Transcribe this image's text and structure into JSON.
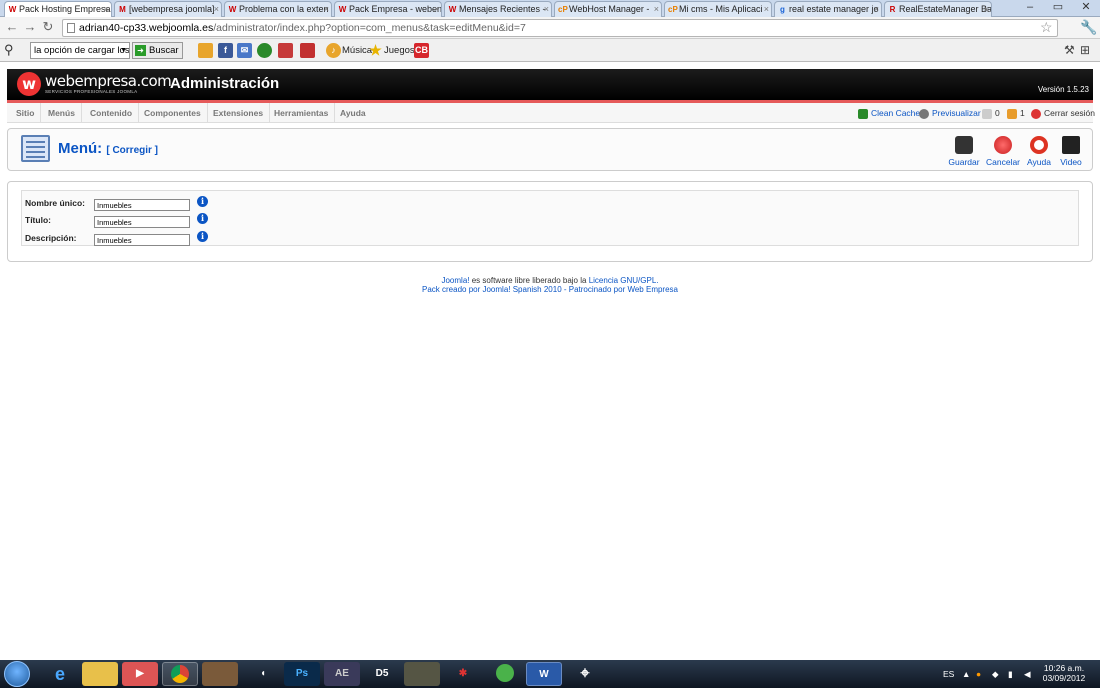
{
  "browser": {
    "tabs": [
      {
        "label": "Pack Hosting Empresa",
        "fav": "W",
        "active": true
      },
      {
        "label": "[webempresa joomla]",
        "fav": "M",
        "active": false
      },
      {
        "label": "Problema con la exten",
        "fav": "W",
        "active": false
      },
      {
        "label": "Pack Empresa - weben",
        "fav": "W",
        "active": false
      },
      {
        "label": "Mensajes Recientes -",
        "fav": "W",
        "active": false
      },
      {
        "label": "WebHost Manager -",
        "fav": "cP",
        "active": false
      },
      {
        "label": "Mi cms - Mis Aplicaci",
        "fav": "cP",
        "active": false
      },
      {
        "label": "real estate manager jo",
        "fav": "g",
        "active": false
      },
      {
        "label": "RealEstateManager Ba",
        "fav": "R",
        "active": false
      }
    ],
    "url_host": "adrian40-cp33.webjoomla.es",
    "url_path": "/administrator/index.php?option=com_menus&task=editMenu&id=7",
    "toolbar": {
      "search_value": "la opción de cargar los",
      "search_button": "Buscar",
      "musica": "Música",
      "juegos": "Juegos"
    }
  },
  "header": {
    "logo": "webempresa.com",
    "logo_sub": "SERVICIOS PROFESIONALES JOOMLA",
    "title": "Administración",
    "version": "Versión 1.5.23"
  },
  "menubar": {
    "items": [
      "Sitio",
      "Menús",
      "Contenido",
      "Componentes",
      "Extensiones",
      "Herramientas",
      "Ayuda"
    ],
    "clean_cache": "Clean Cache",
    "preview": "Previsualizar",
    "messages_count": "0",
    "users_count": "1",
    "logout": "Cerrar sesión"
  },
  "page": {
    "title": "Menú:",
    "subtitle": "[ Corregir ]",
    "buttons": {
      "save": "Guardar",
      "cancel": "Cancelar",
      "help": "Ayuda",
      "video": "Video"
    }
  },
  "form": {
    "unique_name_label": "Nombre único:",
    "unique_name_value": "Inmuebles",
    "title_label": "Título:",
    "title_value": "Inmuebles",
    "description_label": "Descripción:",
    "description_value": "Inmuebles"
  },
  "footer": {
    "joomla": "Joomla!",
    "line1_mid": " es software libre liberado bajo la ",
    "license": "Licencia GNU/GPL.",
    "line2": "Pack creado por Joomla! Spanish 2010 - Patrocinado por Web Empresa"
  },
  "taskbar": {
    "lang": "ES",
    "time": "10:26 a.m.",
    "date": "03/09/2012",
    "apps": [
      "Ps",
      "AE",
      "D5",
      "W"
    ]
  },
  "colors": {
    "link_blue": "#0b55c4",
    "accent_red": "#e55a5a",
    "header_black": "#000000"
  }
}
